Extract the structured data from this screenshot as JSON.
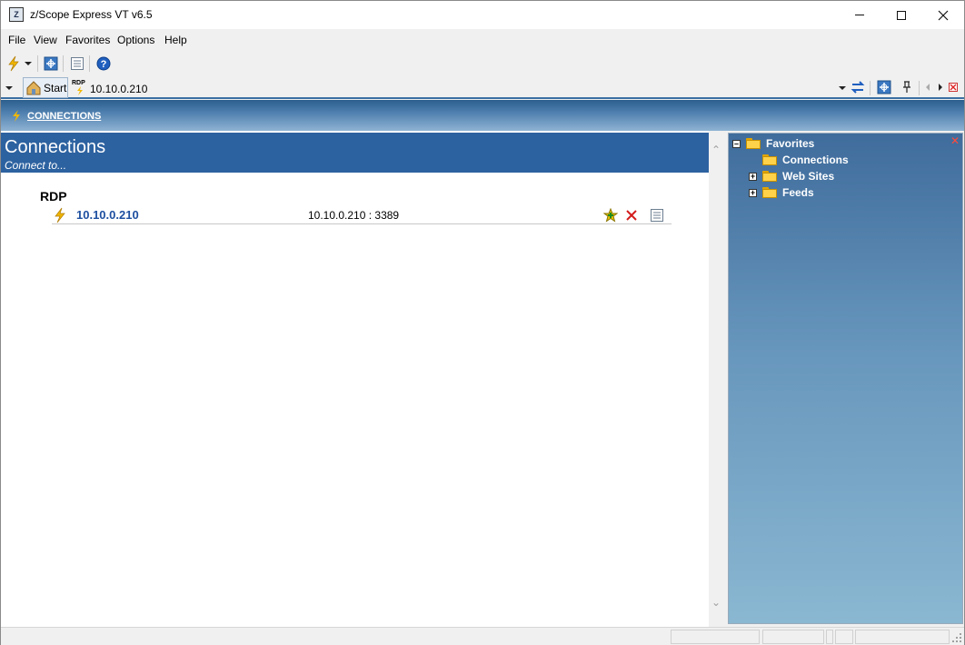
{
  "window": {
    "title": "z/Scope Express VT v6.5",
    "app_icon_text": "Z"
  },
  "menu": [
    "File",
    "View",
    "Favorites",
    "Options",
    "Help"
  ],
  "tabs": {
    "start_label": "Start",
    "rdp_badge": "RDP",
    "session_label": "10.10.0.210"
  },
  "breadcrumb": {
    "label": "CONNECTIONS"
  },
  "main": {
    "title": "Connections",
    "subtitle": "Connect to...",
    "group": "RDP",
    "connection": {
      "name": "10.10.0.210",
      "address": "10.10.0.210 : 3389"
    }
  },
  "favorites": {
    "root": "Favorites",
    "items": [
      {
        "label": "Connections",
        "expandable": false
      },
      {
        "label": "Web Sites",
        "expandable": true
      },
      {
        "label": "Feeds",
        "expandable": true
      }
    ]
  },
  "colors": {
    "accent": "#2d62a0",
    "link": "#1e4fa0",
    "bolt": "#f2b800"
  },
  "icons": {
    "toolbar": [
      "lightning-icon",
      "dropdown-arrow-icon",
      "network-icon",
      "list-icon",
      "help-icon"
    ],
    "row": [
      "lightning-icon",
      "add-favorite-icon",
      "delete-icon",
      "properties-icon"
    ]
  }
}
